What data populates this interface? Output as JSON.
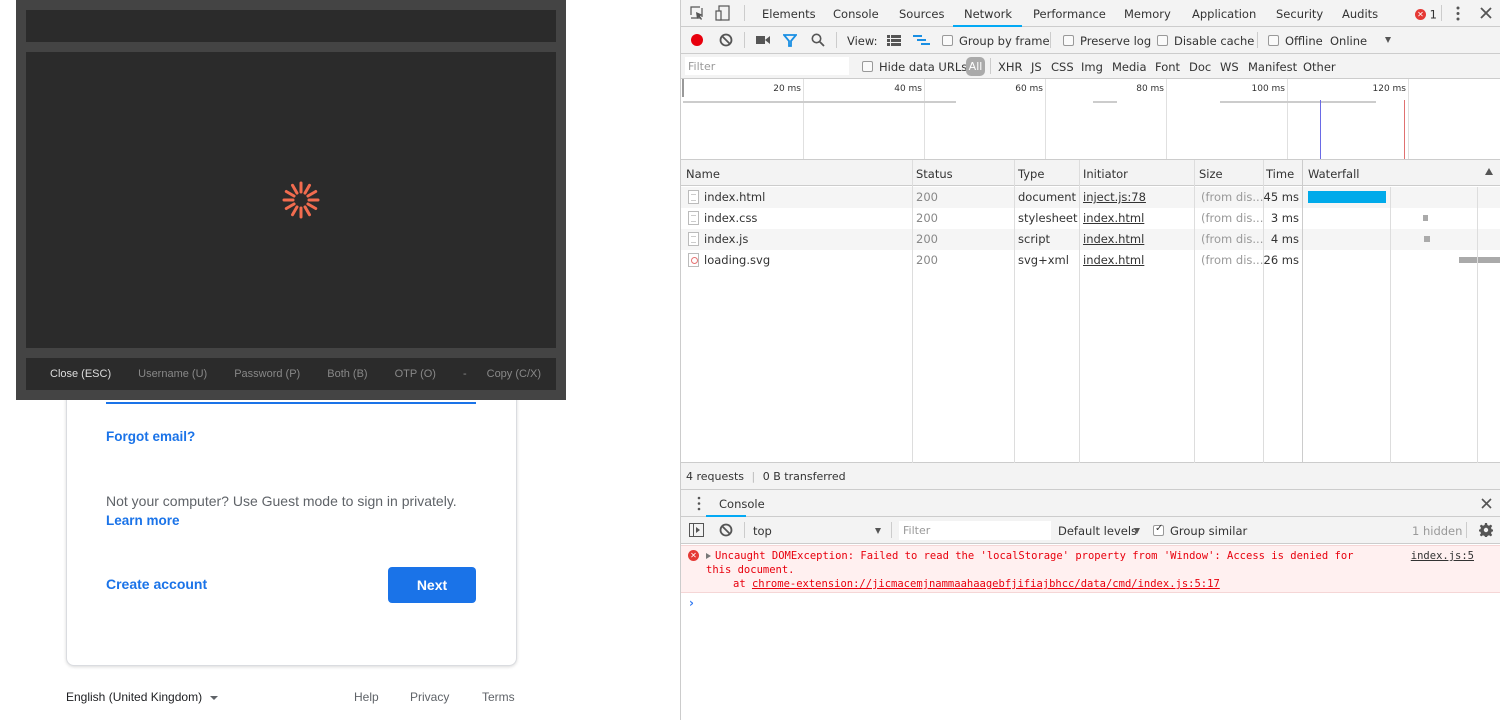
{
  "login_page": {
    "forgot_email": "Forgot email?",
    "guest_text": "Not your computer? Use Guest mode to sign in privately.",
    "learn_more": "Learn more",
    "create_account": "Create account",
    "next": "Next",
    "footer": {
      "language": "English (United Kingdom)",
      "help": "Help",
      "privacy": "Privacy",
      "terms": "Terms"
    },
    "accent_color": "#1a73e8"
  },
  "overlay": {
    "spinner_color": "#f26c4f",
    "actions": [
      {
        "label": "Close (ESC)"
      },
      {
        "label": "Username (U)"
      },
      {
        "label": "Password (P)"
      },
      {
        "label": "Both (B)"
      },
      {
        "label": "OTP (O)"
      },
      {
        "label": "-"
      },
      {
        "label": "Copy (C/X)"
      }
    ]
  },
  "devtools": {
    "tabs": [
      {
        "label": "Elements"
      },
      {
        "label": "Console"
      },
      {
        "label": "Sources"
      },
      {
        "label": "Network",
        "active": true
      },
      {
        "label": "Performance"
      },
      {
        "label": "Memory"
      },
      {
        "label": "Application"
      },
      {
        "label": "Security"
      },
      {
        "label": "Audits"
      }
    ],
    "error_count": "1",
    "toolbar": {
      "view_label": "View:",
      "group_by_frame": "Group by frame",
      "preserve_log": "Preserve log",
      "disable_cache": "Disable cache",
      "offline": "Offline",
      "throttle": "Online"
    },
    "filter": {
      "placeholder": "Filter",
      "hide_data_urls": "Hide data URLs",
      "types": [
        "All",
        "XHR",
        "JS",
        "CSS",
        "Img",
        "Media",
        "Font",
        "Doc",
        "WS",
        "Manifest",
        "Other"
      ]
    },
    "overview_ticks": [
      "20 ms",
      "40 ms",
      "60 ms",
      "80 ms",
      "100 ms",
      "120 ms"
    ],
    "table": {
      "columns": [
        "Name",
        "Status",
        "Type",
        "Initiator",
        "Size",
        "Time",
        "Waterfall"
      ],
      "rows": [
        {
          "name": "index.html",
          "status": "200",
          "type": "document",
          "initiator": "inject.js:78",
          "size": "(from dis...",
          "time": "45 ms"
        },
        {
          "name": "index.css",
          "status": "200",
          "type": "stylesheet",
          "initiator": "index.html",
          "size": "(from dis...",
          "time": "3 ms"
        },
        {
          "name": "index.js",
          "status": "200",
          "type": "script",
          "initiator": "index.html",
          "size": "(from dis...",
          "time": "4 ms"
        },
        {
          "name": "loading.svg",
          "status": "200",
          "type": "svg+xml",
          "initiator": "index.html",
          "size": "(from dis...",
          "time": "26 ms"
        }
      ]
    },
    "summary": {
      "requests": "4 requests",
      "transferred": "0 B transferred"
    },
    "drawer": {
      "tab": "Console",
      "context": "top",
      "filter_placeholder": "Filter",
      "levels": "Default levels",
      "group_similar": "Group similar",
      "hidden": "1 hidden"
    },
    "console_messages": [
      {
        "level": "error",
        "line1": "Uncaught DOMException: Failed to read the 'localStorage' property from 'Window': Access is denied for",
        "line2": "this document.",
        "at_prefix": "at ",
        "at_link": "chrome-extension://jicmacemjnammaahaagebfjifiajbhcc/data/cmd/index.js:5:17",
        "source": "index.js:5"
      }
    ]
  }
}
